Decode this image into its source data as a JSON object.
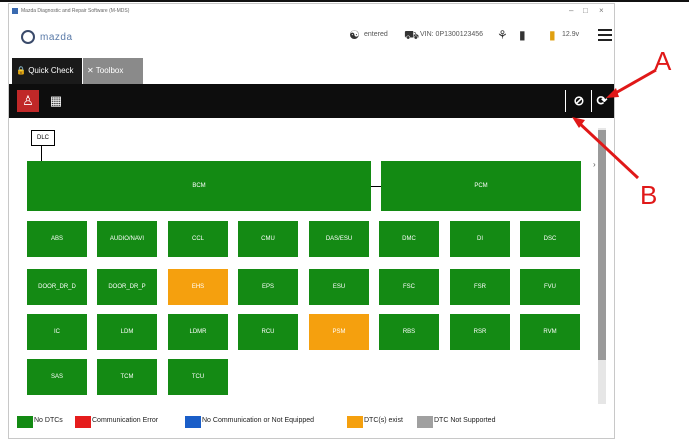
{
  "window": {
    "title": "Mazda Diagnostic and Repair Software (M-MDS)"
  },
  "header": {
    "brand": "mazda",
    "user": "entered",
    "vehicle": "VIN: 0P1300123456",
    "battery": "12.9v"
  },
  "tabs": [
    {
      "label": "Quick Check",
      "icon": "lock-icon"
    },
    {
      "label": "Toolbox",
      "icon": "wrench-icon"
    }
  ],
  "diagram": {
    "root_node": "DLC",
    "buses": [
      "BCM",
      "PCM"
    ],
    "modules": [
      [
        {
          "label": "ABS",
          "state": "ok"
        },
        {
          "label": "AUDIO/NAVI",
          "state": "ok"
        },
        {
          "label": "CCL",
          "state": "ok"
        },
        {
          "label": "CMU",
          "state": "ok"
        },
        {
          "label": "DAS/ESU",
          "state": "ok"
        },
        {
          "label": "DMC",
          "state": "ok"
        },
        {
          "label": "DI",
          "state": "ok"
        },
        {
          "label": "DSC",
          "state": "ok"
        }
      ],
      [
        {
          "label": "DOOR_DR_D",
          "state": "ok"
        },
        {
          "label": "DOOR_DR_P",
          "state": "ok"
        },
        {
          "label": "EHS",
          "state": "dtc"
        },
        {
          "label": "EPS",
          "state": "ok"
        },
        {
          "label": "ESU",
          "state": "ok"
        },
        {
          "label": "FSC",
          "state": "ok"
        },
        {
          "label": "FSR",
          "state": "ok"
        },
        {
          "label": "FVU",
          "state": "ok"
        }
      ],
      [
        {
          "label": "IC",
          "state": "ok"
        },
        {
          "label": "LDM",
          "state": "ok"
        },
        {
          "label": "LDMR",
          "state": "ok"
        },
        {
          "label": "RCU",
          "state": "ok"
        },
        {
          "label": "PSM",
          "state": "dtc"
        },
        {
          "label": "RBS",
          "state": "ok"
        },
        {
          "label": "RSR",
          "state": "ok"
        },
        {
          "label": "RVM",
          "state": "ok"
        }
      ],
      [
        {
          "label": "SAS",
          "state": "ok"
        },
        {
          "label": "TCM",
          "state": "ok"
        },
        {
          "label": "TCU",
          "state": "ok"
        }
      ]
    ]
  },
  "legend": [
    {
      "label": "No DTCs",
      "color": "#138a13"
    },
    {
      "label": "Communication Error",
      "color": "#e51c1c"
    },
    {
      "label": "No Communication or Not Equipped",
      "color": "#1a5ec8"
    },
    {
      "label": "DTC(s) exist",
      "color": "#f5a00e"
    },
    {
      "label": "DTC Not Supported",
      "color": "#a0a0a0"
    }
  ],
  "callouts": {
    "a": "A",
    "b": "B"
  }
}
